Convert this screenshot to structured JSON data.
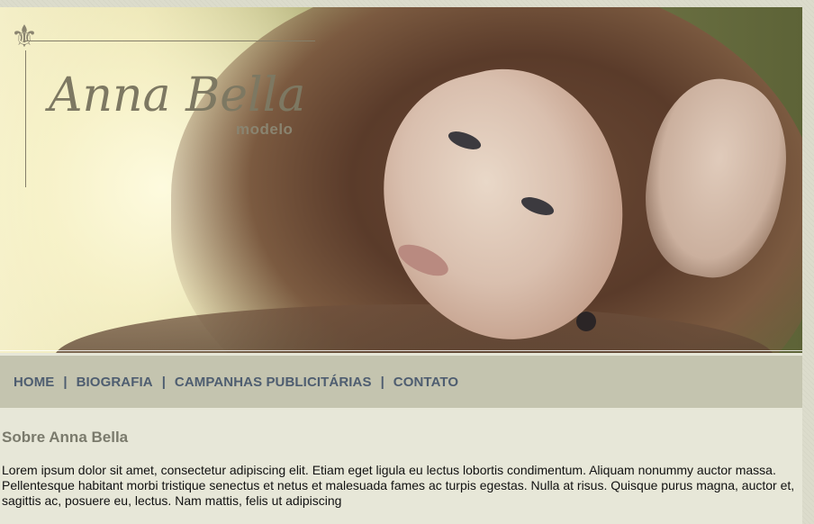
{
  "logo": {
    "name": "Anna Bella",
    "subtitle": "modelo",
    "ornament_icon": "fleur-de-lis-icon"
  },
  "nav": {
    "items": [
      {
        "label": "HOME"
      },
      {
        "label": "BIOGRAFIA"
      },
      {
        "label": "CAMPANHAS PUBLICITÁRIAS"
      },
      {
        "label": "CONTATO"
      }
    ],
    "separator": "|"
  },
  "content": {
    "heading": "Sobre Anna Bella",
    "paragraph": "Lorem ipsum dolor sit amet, consectetur adipiscing elit. Etiam eget ligula eu lectus lobortis condimentum. Aliquam nonummy auctor massa. Pellentesque habitant morbi tristique senectus et netus et malesuada fames ac turpis egestas. Nulla at risus. Quisque purus magna, auctor et, sagittis ac, posuere eu, lectus. Nam mattis, felis ut adipiscing"
  },
  "colors": {
    "page_bg": "#e7e7d8",
    "nav_bg": "#c4c4af",
    "nav_text": "#4e5d70",
    "heading": "#7a7a6c",
    "logo": "#7d7862"
  }
}
